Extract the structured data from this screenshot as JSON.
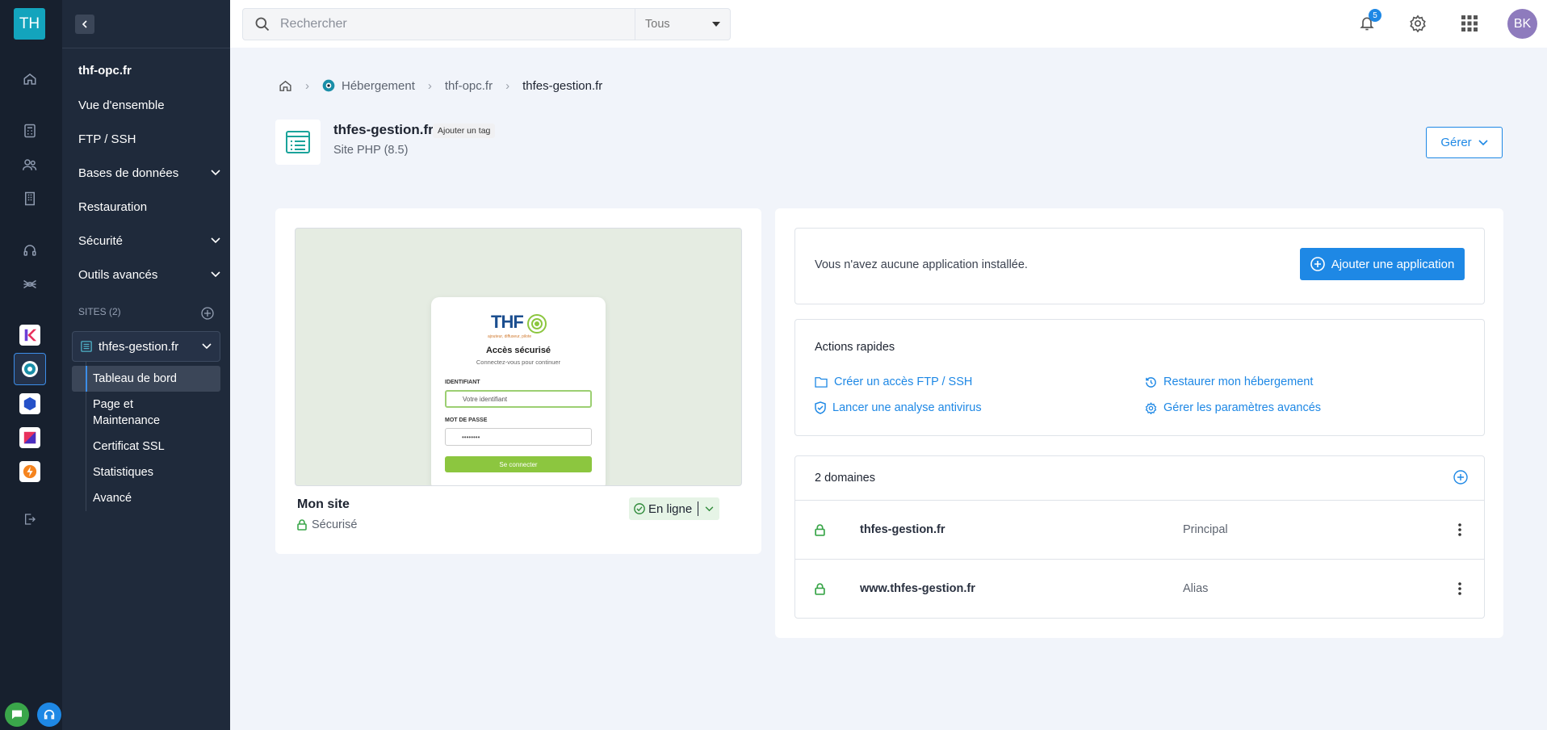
{
  "app": {
    "logo_text": "TH"
  },
  "subnav": {
    "domain": "thf-opc.fr",
    "items": [
      {
        "label": "Vue d'ensemble"
      },
      {
        "label": "FTP / SSH"
      },
      {
        "label": "Bases de données"
      },
      {
        "label": "Restauration"
      },
      {
        "label": "Sécurité"
      },
      {
        "label": "Outils avancés"
      }
    ],
    "sites_label": "SITES (2)",
    "current_site": "thfes-gestion.fr",
    "site_items": [
      {
        "label": "Tableau de bord"
      },
      {
        "label": "Page et Maintenance"
      },
      {
        "label": "Certificat SSL"
      },
      {
        "label": "Statistiques"
      },
      {
        "label": "Avancé"
      }
    ]
  },
  "topbar": {
    "search_placeholder": "Rechercher",
    "search_scope": "Tous",
    "notifications_count": "5",
    "avatar_initials": "BK"
  },
  "breadcrumb": {
    "items": [
      "Hébergement",
      "thf-opc.fr",
      "thfes-gestion.fr"
    ]
  },
  "site": {
    "title": "thfes-gestion.fr",
    "tag_button": "Ajouter un tag",
    "subtitle": "Site PHP (8.5)",
    "manage_label": "Gérer"
  },
  "preview": {
    "brand": "THF",
    "brand_tagline": "ajouteur, diffuseur, pilote",
    "heading": "Accès sécurisé",
    "subheading": "Connectez-vous pour continuer",
    "user_label": "IDENTIFIANT",
    "user_placeholder": "Votre identifiant",
    "pass_label": "MOT DE PASSE",
    "pass_value": "••••••••",
    "submit_label": "Se connecter"
  },
  "site_card": {
    "name": "Mon site",
    "secure_label": "Sécurisé",
    "status": "En ligne"
  },
  "apps": {
    "empty_text": "Vous n'avez aucune application installée.",
    "add_label": "Ajouter une application"
  },
  "quick_actions": {
    "title": "Actions rapides",
    "links": [
      {
        "label": "Créer un accès FTP / SSH",
        "icon": "folder-icon"
      },
      {
        "label": "Restaurer mon hébergement",
        "icon": "history-icon"
      },
      {
        "label": "Lancer une analyse antivirus",
        "icon": "shield-check-icon"
      },
      {
        "label": "Gérer les paramètres avancés",
        "icon": "gear-icon"
      }
    ]
  },
  "domains": {
    "title": "2 domaines",
    "rows": [
      {
        "name": "thfes-gestion.fr",
        "type": "Principal"
      },
      {
        "name": "www.thfes-gestion.fr",
        "type": "Alias"
      }
    ]
  },
  "colors": {
    "accent": "#1e88e5",
    "rail": "#17202e",
    "subnav": "#1f2a3b",
    "success": "#3aa64a"
  }
}
